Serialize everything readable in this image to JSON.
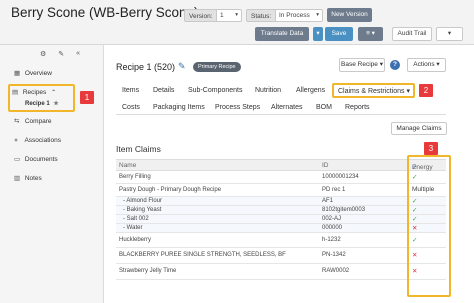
{
  "header": {
    "title": "Berry Scone (WB-Berry Scone)",
    "version_label": "Version:",
    "version_value": "1",
    "status_label": "Status:",
    "status_value": "In Process",
    "new_version": "New Version",
    "translate": "Translate Data",
    "save": "Save",
    "menu_icon": "≡",
    "audit": "Audit Trail"
  },
  "sidebar": {
    "items": [
      {
        "label": "Overview",
        "icon": "▦"
      },
      {
        "label": "Recipes",
        "icon": "▤",
        "sub": "Recipe 1",
        "expanded": true
      },
      {
        "label": "Compare",
        "icon": "⇆"
      },
      {
        "label": "Associations",
        "icon": "⋄"
      },
      {
        "label": "Documents",
        "icon": "▭"
      },
      {
        "label": "Notes",
        "icon": "▥"
      }
    ]
  },
  "recipe": {
    "title": "Recipe 1 (520)",
    "badge": "Primary Recipe",
    "base_recipe": "Base Recipe ▾",
    "actions": "Actions ▾"
  },
  "tabs": {
    "row1": [
      "Items",
      "Details",
      "Sub-Components",
      "Nutrition",
      "Allergens",
      "Claims & Restrictions ▾"
    ],
    "row2": [
      "Costs",
      "Packaging Items",
      "Process Steps",
      "Alternates",
      "BOM",
      "Reports"
    ]
  },
  "manage_claims": "Manage Claims",
  "section": "Item Claims",
  "table": {
    "headers": {
      "name": "Name",
      "id": "ID",
      "energy": "Energy"
    },
    "rows": [
      {
        "name": "Berry Filling",
        "id": "10000001234",
        "energy": "✓",
        "status": "ok",
        "sub": false
      },
      {
        "name": "Pastry Dough - Primary Dough Recipe",
        "id": "PD rec 1",
        "energy": "Multiple",
        "status": "multi",
        "sub": false
      },
      {
        "name": "- Almond Flour",
        "id": "AF1",
        "energy": "✓",
        "status": "ok",
        "sub": true
      },
      {
        "name": "- Baking Yeast",
        "id": "8102tgitem0003",
        "energy": "✓",
        "status": "ok",
        "sub": true
      },
      {
        "name": "- Salt 002",
        "id": "002-AJ",
        "energy": "✓",
        "status": "ok",
        "sub": true
      },
      {
        "name": "- Water",
        "id": "000000",
        "energy": "✕",
        "status": "no",
        "sub": true
      },
      {
        "name": "Huckleberry",
        "id": "h-1232",
        "energy": "✓",
        "status": "ok",
        "sub": false
      },
      {
        "name": "BLACKBERRY PUREE SINGLE STRENGTH, SEEDLESS, BF",
        "id": "PN-1342",
        "energy": "✕",
        "status": "no",
        "sub": false
      },
      {
        "name": "Strawberry Jelly Time",
        "id": "RAW0002",
        "energy": "✕",
        "status": "no",
        "sub": false
      }
    ]
  },
  "steps": [
    "1",
    "2",
    "3"
  ],
  "colors": {
    "highlight": "#f2b62a",
    "step_badge": "#e83a3a",
    "ok": "#3aa641",
    "no": "#d9363e",
    "primary": "#4a90c2"
  }
}
